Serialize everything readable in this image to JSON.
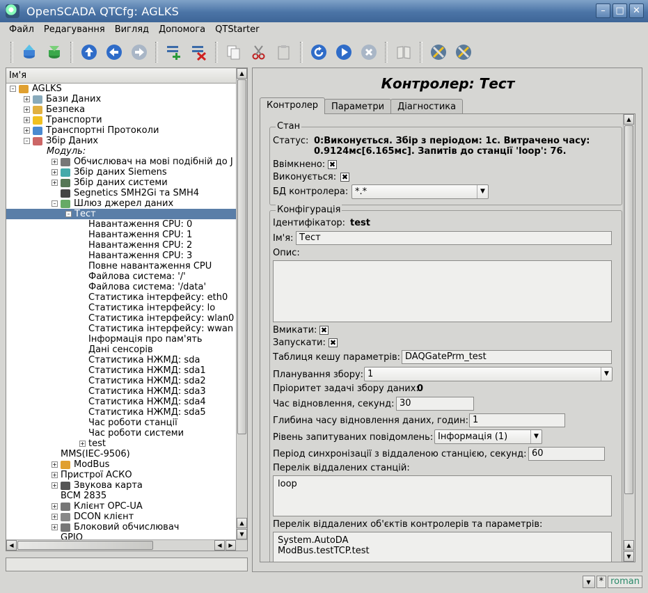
{
  "window": {
    "title": "OpenSCADA QTCfg: AGLKS"
  },
  "menu": [
    {
      "label": "Файл"
    },
    {
      "label": "Редагування"
    },
    {
      "label": "Вигляд"
    },
    {
      "label": "Допомога"
    },
    {
      "label": "QTStarter"
    }
  ],
  "tree": {
    "header": "Ім'я",
    "rows": [
      {
        "label": "AGLKS"
      },
      {
        "label": "Бази Даних"
      },
      {
        "label": "Безпека"
      },
      {
        "label": "Транспорти"
      },
      {
        "label": "Транспортні Протоколи"
      },
      {
        "label": "Збір Даних"
      },
      {
        "label": "Модуль:"
      },
      {
        "label": "Обчислювач на мові подібній до J"
      },
      {
        "label": "Збір даних Siemens"
      },
      {
        "label": "Збір даних системи"
      },
      {
        "label": "Segnetics SMH2Gi та SMH4"
      },
      {
        "label": "Шлюз джерел даних"
      },
      {
        "label": "Тест"
      },
      {
        "label": "Навантаження CPU: 0"
      },
      {
        "label": "Навантаження CPU: 1"
      },
      {
        "label": "Навантаження CPU: 2"
      },
      {
        "label": "Навантаження CPU: 3"
      },
      {
        "label": "Повне навантаження CPU"
      },
      {
        "label": "Файлова система: '/'"
      },
      {
        "label": "Файлова система: '/data'"
      },
      {
        "label": "Статистика інтерфейсу: eth0"
      },
      {
        "label": "Статистика інтерфейсу: lo"
      },
      {
        "label": "Статистика інтерфейсу: wlan0"
      },
      {
        "label": "Статистика інтерфейсу: wwan"
      },
      {
        "label": "Інформація про пам'ять"
      },
      {
        "label": "Дані сенсорів"
      },
      {
        "label": "Статистика НЖМД: sda"
      },
      {
        "label": "Статистика НЖМД: sda1"
      },
      {
        "label": "Статистика НЖМД: sda2"
      },
      {
        "label": "Статистика НЖМД: sda3"
      },
      {
        "label": "Статистика НЖМД: sda4"
      },
      {
        "label": "Статистика НЖМД: sda5"
      },
      {
        "label": "Час роботи станції"
      },
      {
        "label": "Час роботи системи"
      },
      {
        "label": "test"
      },
      {
        "label": "MMS(IEC-9506)"
      },
      {
        "label": "ModBus"
      },
      {
        "label": "Пристрої АСКО"
      },
      {
        "label": "Звукова карта"
      },
      {
        "label": "BCM 2835"
      },
      {
        "label": "Клієнт OPC-UA"
      },
      {
        "label": "DCON клієнт"
      },
      {
        "label": "Блоковий обчислювач"
      },
      {
        "label": "GPIO"
      }
    ]
  },
  "page": {
    "title": "Контролер: Тест",
    "tabs": [
      "Контролер",
      "Параметри",
      "Діагностика"
    ],
    "state": {
      "legend": "Стан",
      "status_label": "Статус:",
      "status_line1": "0:Виконується. Збір з періодом: 1с. Витрачено часу:",
      "status_line2": "0.9124мс[6.165мс]. Запитів до станції 'loop': 76.",
      "enabled_label": "Ввімкнено:",
      "running_label": "Виконується:",
      "db_label": "БД контролера:",
      "db_value": "*.*"
    },
    "config": {
      "legend": "Конфігурація",
      "id_label": "Ідентифікатор:",
      "id_value": "test",
      "name_label": "Ім'я:",
      "name_value": "Тест",
      "descr_label": "Опис:",
      "descr_value": "",
      "enable_label": "Вмикати:",
      "start_label": "Запускати:",
      "cache_label": "Таблиця кешу параметрів:",
      "cache_value": "DAQGatePrm_test",
      "schedule_label": "Планування збору:",
      "schedule_value": "1",
      "priority_label": "Пріоритет задачі збору даних:",
      "priority_value": "0",
      "restore_label": "Час відновлення, секунд:",
      "restore_value": "30",
      "depth_label": "Глибина часу відновлення даних, годин:",
      "depth_value": "1",
      "level_label": "Рівень запитуваних повідомлень:",
      "level_value": "Інформація (1)",
      "sync_label": "Період синхронізації з віддаленою станцією, секунд:",
      "sync_value": "60",
      "stations_label": "Перелік віддалених станцій:",
      "stations_value": "loop",
      "objects_label": "Перелік віддалених об'єктів контролерів та параметрів:",
      "objects_line1": "System.AutoDA",
      "objects_line2": "ModBus.testTCP.test"
    }
  },
  "status_bar": {
    "modified_marker": "*",
    "user": "roman"
  }
}
